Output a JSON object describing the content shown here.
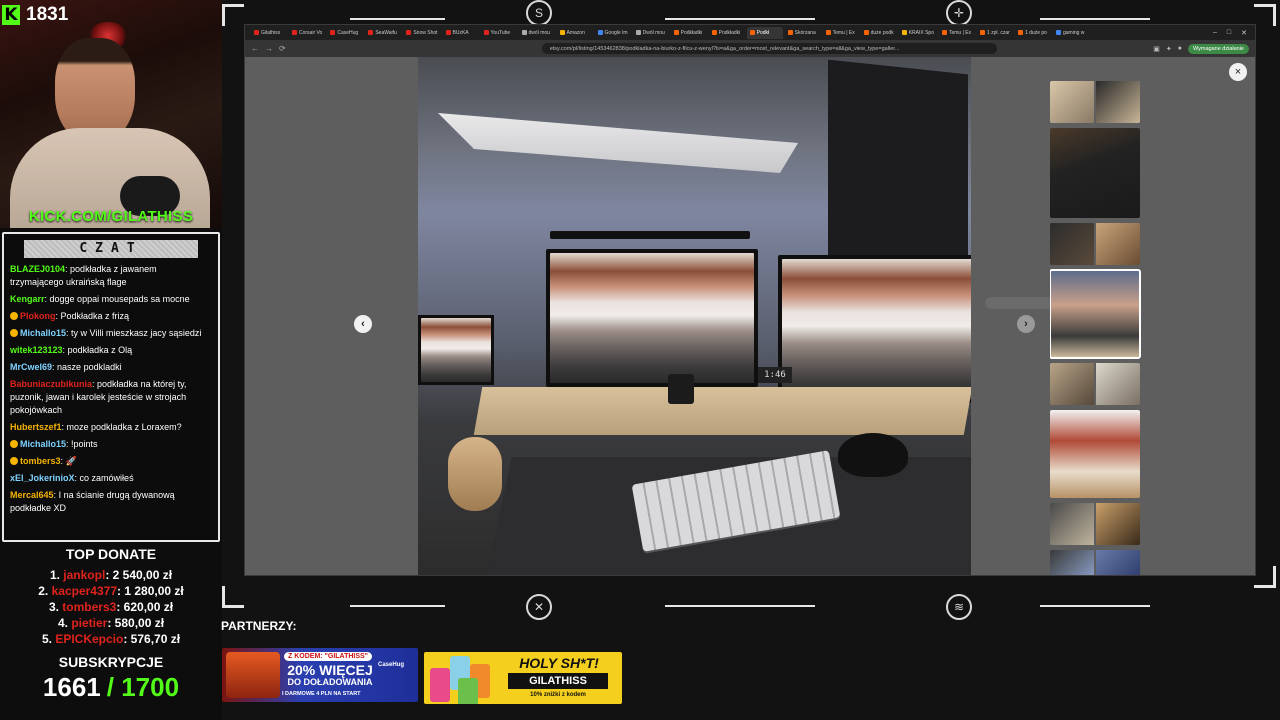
{
  "viewer": {
    "count": "1831"
  },
  "stream": {
    "kick_url": "KICK.COM/GILATHISS"
  },
  "chat": {
    "title": "CZAT",
    "messages": [
      {
        "user": "BLAZEJ0104",
        "color": "#53fc18",
        "text": "podkładka z jawanem trzymającego ukraińską flage",
        "badge": false
      },
      {
        "user": "Kengarr",
        "color": "#53fc18",
        "text": "dogge oppai mousepads sa mocne",
        "badge": false
      },
      {
        "user": "Plokong",
        "color": "#e0231b",
        "text": "Podkładka z frizą",
        "badge": true
      },
      {
        "user": "Michallo15",
        "color": "#7fd3ff",
        "text": "ty w Villi mieszkasz jacy sąsiedzi",
        "badge": true
      },
      {
        "user": "witek123123",
        "color": "#53fc18",
        "text": "podkładka z Olą",
        "badge": false
      },
      {
        "user": "MrCwel69",
        "color": "#7fd3ff",
        "text": "nasze podkladki",
        "badge": false
      },
      {
        "user": "Babuniaczubikunia",
        "color": "#e0231b",
        "text": "podkładka na której ty, puzonik, jawan i karolek jesteście w strojach pokojówkach",
        "badge": false
      },
      {
        "user": "Hubertszef1",
        "color": "#f5b400",
        "text": "moze podkladka z Loraxem?",
        "badge": false
      },
      {
        "user": "Michallo15",
        "color": "#7fd3ff",
        "text": "!points",
        "badge": true
      },
      {
        "user": "tombers3",
        "color": "#f5b400",
        "text": "🚀",
        "badge": true
      },
      {
        "user": "xEl_JokerinioX",
        "color": "#7fd3ff",
        "text": "co zamówiłeś",
        "badge": false
      },
      {
        "user": "Mercal645",
        "color": "#f5b400",
        "text": "I na ścianie drugą dywanową podkładke XD",
        "badge": false
      }
    ]
  },
  "donate": {
    "title": "TOP DONATE",
    "rows": [
      {
        "rank": "1.",
        "name": "jankopl",
        "amount": "2 540,00 zł"
      },
      {
        "rank": "2.",
        "name": "kacper4377",
        "amount": "1 280,00 zł"
      },
      {
        "rank": "3.",
        "name": "tombers3",
        "amount": "620,00 zł"
      },
      {
        "rank": "4.",
        "name": "pietier",
        "amount": "580,00 zł"
      },
      {
        "rank": "5.",
        "name": "EPICKepcio",
        "amount": "576,70 zł"
      }
    ]
  },
  "subs": {
    "title": "SUBSKRYPCJE",
    "current": "1661",
    "goal": "/ 1700"
  },
  "partners": {
    "label": "PARTNERZY:",
    "banner1": {
      "code": "Z KODEM: \"GILATHISS\"",
      "line1": "20% WIĘCEJ",
      "line2": "DO DOŁADOWANIA",
      "line3": "I DARMOWE 4 PLN NA START",
      "brand": "CaseHug"
    },
    "banner2": {
      "title": "HOLY SH*T!",
      "code": "GILATHISS",
      "discount": "10% zniżki z kodem"
    }
  },
  "browser": {
    "tabs": [
      {
        "label": "Gilathiss",
        "color": "#e0231b",
        "active": false
      },
      {
        "label": "Corsair Vo",
        "color": "#e0231b",
        "active": false
      },
      {
        "label": "CaseHug",
        "color": "#e0231b",
        "active": false
      },
      {
        "label": "SeaWaifu",
        "color": "#e0231b",
        "active": false
      },
      {
        "label": "Snow Shot",
        "color": "#e0231b",
        "active": false
      },
      {
        "label": "BUzKA",
        "color": "#e0231b",
        "active": false
      },
      {
        "label": "YouTube",
        "color": "#e0231b",
        "active": false
      },
      {
        "label": "dwól mou",
        "color": "#aaaaaa",
        "active": false
      },
      {
        "label": "Amazon",
        "color": "#f5b400",
        "active": false
      },
      {
        "label": "Google Im",
        "color": "#4285f4",
        "active": false
      },
      {
        "label": "Dwól mou",
        "color": "#aaaaaa",
        "active": false
      },
      {
        "label": "Podkładki",
        "color": "#f56400",
        "active": false
      },
      {
        "label": "Podkładki",
        "color": "#f56400",
        "active": false
      },
      {
        "label": "Podkł",
        "color": "#f56400",
        "active": true
      },
      {
        "label": "Skórzana",
        "color": "#f56400",
        "active": false
      },
      {
        "label": "Temu | Ex",
        "color": "#f56400",
        "active": false
      },
      {
        "label": "duże podk",
        "color": "#f56400",
        "active": false
      },
      {
        "label": "KRAIX Spo",
        "color": "#f5b400",
        "active": false
      },
      {
        "label": "Temu | Ex",
        "color": "#f56400",
        "active": false
      },
      {
        "label": "1 zpl. czar",
        "color": "#f56400",
        "active": false
      },
      {
        "label": "1 duże po",
        "color": "#f56400",
        "active": false
      },
      {
        "label": "gaming w",
        "color": "#4285f4",
        "active": false
      }
    ],
    "url": "etsy.com/pl/listing/1453462838/podkladka-na-biurko-z-filcu-z-wenyl?ls=a&ga_order=most_relevant&ga_search_type=all&ga_view_type=galler...",
    "update_label": "Wymagane działanie",
    "clock_text": "1:46"
  },
  "icons": {
    "back": "←",
    "forward": "→",
    "reload": "⟳",
    "close": "×",
    "prev": "‹",
    "next": "›"
  },
  "colors": {
    "kick_green": "#53fc18",
    "donor_red": "#e0231b"
  }
}
